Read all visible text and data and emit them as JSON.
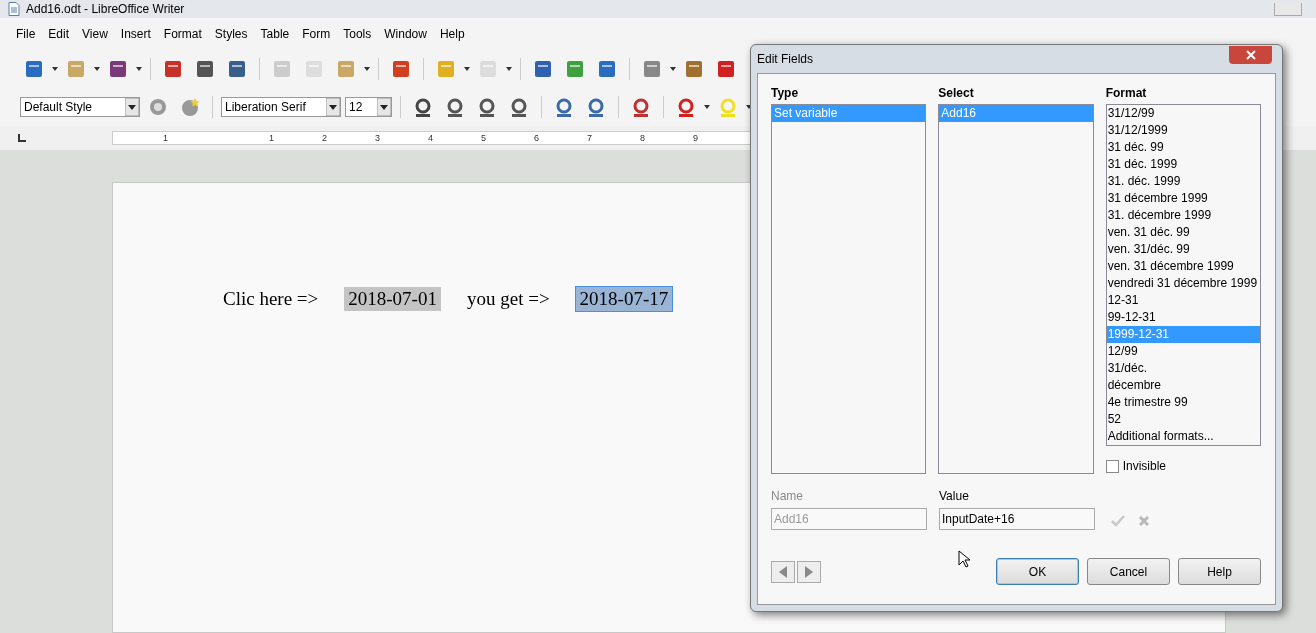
{
  "window": {
    "title": "Add16.odt - LibreOffice Writer"
  },
  "menu": [
    "File",
    "Edit",
    "View",
    "Insert",
    "Format",
    "Styles",
    "Table",
    "Form",
    "Tools",
    "Window",
    "Help"
  ],
  "formatting": {
    "paragraph_style": "Default Style",
    "font_name": "Liberation Serif",
    "font_size": "12"
  },
  "ruler": [
    "1",
    "1",
    "2",
    "3",
    "4",
    "5",
    "6",
    "7",
    "8",
    "9"
  ],
  "document": {
    "segments": [
      {
        "kind": "text",
        "text": "Clic here =>"
      },
      {
        "kind": "field",
        "text": "2018-07-01",
        "selected": false
      },
      {
        "kind": "text",
        "text": "you get =>"
      },
      {
        "kind": "field",
        "text": "2018-07-17",
        "selected": true
      }
    ]
  },
  "dialog": {
    "title": "Edit Fields",
    "type": {
      "label": "Type",
      "items": [
        {
          "label": "Set variable",
          "selected": true
        }
      ]
    },
    "select": {
      "label": "Select",
      "items": [
        {
          "label": "Add16",
          "selected": true
        }
      ]
    },
    "format": {
      "label": "Format",
      "items": [
        {
          "label": "31/12/99",
          "selected": false
        },
        {
          "label": "31/12/1999",
          "selected": false
        },
        {
          "label": "31 déc. 99",
          "selected": false
        },
        {
          "label": "31 déc. 1999",
          "selected": false
        },
        {
          "label": "31. déc. 1999",
          "selected": false
        },
        {
          "label": "31 décembre 1999",
          "selected": false
        },
        {
          "label": "31. décembre 1999",
          "selected": false
        },
        {
          "label": "ven. 31 déc. 99",
          "selected": false
        },
        {
          "label": "ven. 31/déc. 99",
          "selected": false
        },
        {
          "label": "ven. 31 décembre 1999",
          "selected": false
        },
        {
          "label": "vendredi 31 décembre 1999",
          "selected": false
        },
        {
          "label": "12-31",
          "selected": false
        },
        {
          "label": "99-12-31",
          "selected": false
        },
        {
          "label": "1999-12-31",
          "selected": true
        },
        {
          "label": "12/99",
          "selected": false
        },
        {
          "label": "31/déc.",
          "selected": false
        },
        {
          "label": "décembre",
          "selected": false
        },
        {
          "label": "4e trimestre 99",
          "selected": false
        },
        {
          "label": "52",
          "selected": false
        },
        {
          "label": "Additional formats...",
          "selected": false
        }
      ]
    },
    "invisible": {
      "label": "Invisible",
      "checked": false
    },
    "name": {
      "label": "Name",
      "value": "Add16",
      "disabled": true
    },
    "value": {
      "label": "Value",
      "value": "InputDate+16",
      "disabled": false
    },
    "buttons": [
      {
        "label": "OK",
        "default": true
      },
      {
        "label": "Cancel",
        "default": false
      },
      {
        "label": "Help",
        "default": false
      }
    ]
  }
}
